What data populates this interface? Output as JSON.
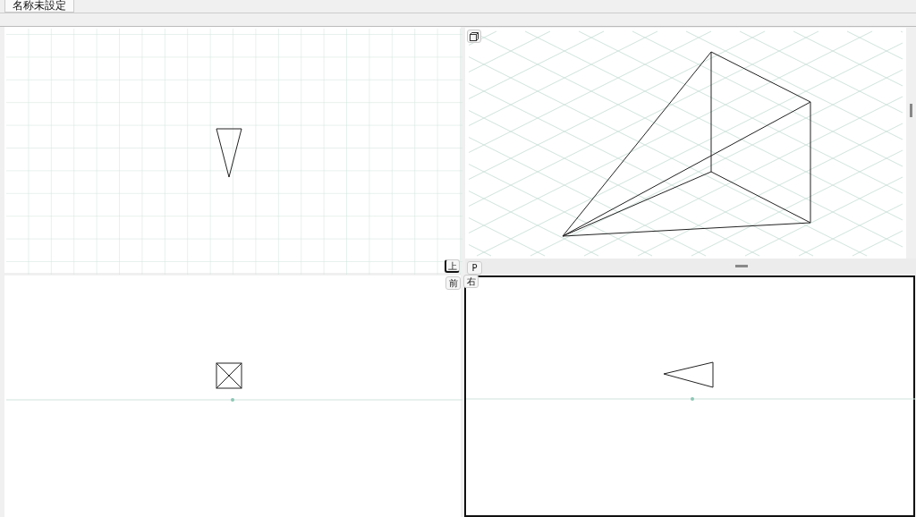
{
  "document_tab": {
    "label": "名称未設定",
    "selected": true
  },
  "viewports": [
    {
      "kind": "top",
      "label": "上",
      "selected": false
    },
    {
      "kind": "perspective",
      "label": "P",
      "selected": false
    },
    {
      "kind": "front",
      "label": "前",
      "selected": false
    },
    {
      "kind": "right",
      "label": "右",
      "selected": true
    }
  ]
}
